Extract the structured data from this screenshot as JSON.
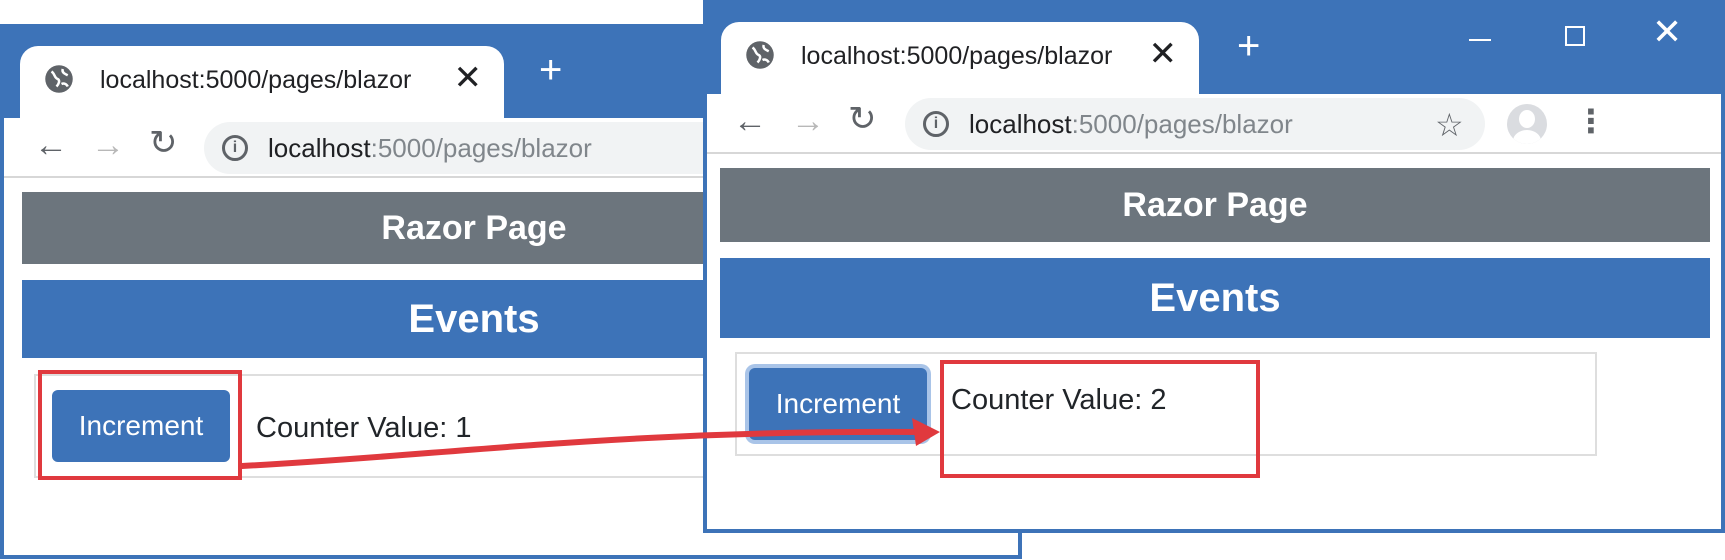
{
  "colors": {
    "browser_frame": "#3d73b8",
    "header_gray": "#6c757d",
    "header_blue": "#3d73b8",
    "button_primary": "#3d73b8",
    "highlight_red": "#e0393e"
  },
  "windows": [
    {
      "tab": {
        "title": "localhost:5000/pages/blazor",
        "close_glyph": "✕",
        "icon": "globe-icon"
      },
      "new_tab_glyph": "+",
      "toolbar": {
        "back_glyph": "←",
        "forward_glyph": "→",
        "reload_glyph": "↻",
        "url_host": "localhost",
        "url_path": ":5000/pages/blazor",
        "info_glyph": "i"
      },
      "page": {
        "header": "Razor Page",
        "title": "Events",
        "button_label": "Increment",
        "counter_text": "Counter Value: 1"
      }
    },
    {
      "tab": {
        "title": "localhost:5000/pages/blazor",
        "close_glyph": "✕",
        "icon": "globe-icon"
      },
      "new_tab_glyph": "+",
      "window_controls": {
        "close_glyph": "✕"
      },
      "toolbar": {
        "back_glyph": "←",
        "forward_glyph": "→",
        "reload_glyph": "↻",
        "url_host": "localhost",
        "url_path": ":5000/pages/blazor",
        "info_glyph": "i",
        "star_glyph": "☆",
        "menu_glyph": "⋮"
      },
      "page": {
        "header": "Razor Page",
        "title": "Events",
        "button_label": "Increment",
        "counter_text": "Counter Value: 2"
      }
    }
  ]
}
